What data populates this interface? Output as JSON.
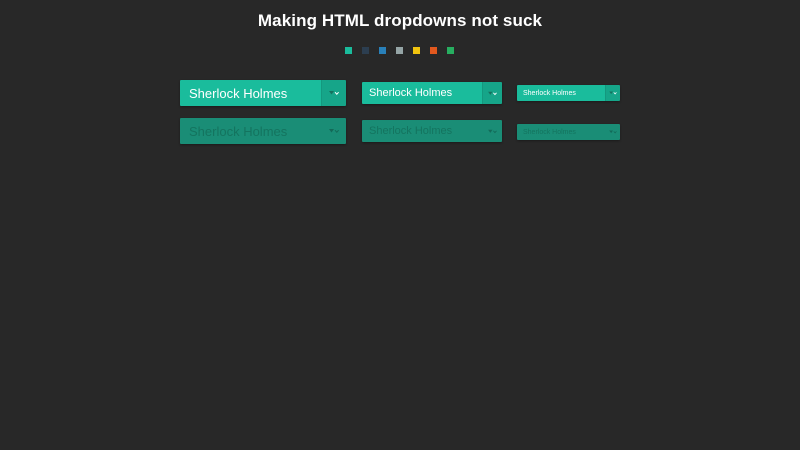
{
  "page": {
    "title": "Making HTML dropdowns not suck"
  },
  "theme_swatches": [
    {
      "name": "turquoise",
      "color": "#1abc9c"
    },
    {
      "name": "midnight",
      "color": "#2c3e50"
    },
    {
      "name": "blue",
      "color": "#2980b9"
    },
    {
      "name": "gray",
      "color": "#95a5a6"
    },
    {
      "name": "yellow",
      "color": "#f1c40f"
    },
    {
      "name": "orange",
      "color": "#e2581e"
    },
    {
      "name": "green",
      "color": "#27ae60"
    }
  ],
  "dropdowns": {
    "large": {
      "selected": "Sherlock Holmes"
    },
    "medium": {
      "selected": "Sherlock Holmes"
    },
    "small": {
      "selected": "Sherlock Holmes"
    },
    "large_disabled": {
      "selected": "Sherlock Holmes"
    },
    "medium_disabled": {
      "selected": "Sherlock Holmes"
    },
    "small_disabled": {
      "selected": "Sherlock Holmes"
    }
  },
  "icons": {
    "dropdown_arrow": "up-down-caret-icon"
  },
  "colors": {
    "background": "#282828",
    "accent": "#1abc9c",
    "accent_disabled": "#1a8d76"
  }
}
